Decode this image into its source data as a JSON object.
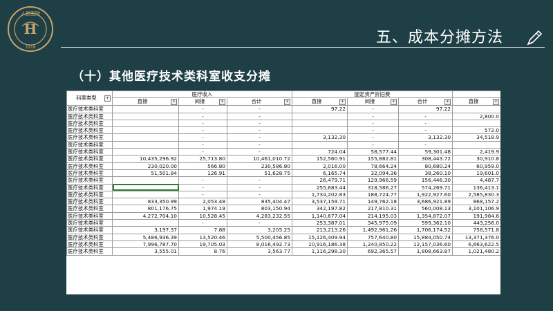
{
  "header": {
    "page_title": "五、成本分摊方法",
    "section_title": "（十）其他医疗技术类科室收支分摊",
    "logo_text": "人民医院 1918"
  },
  "table": {
    "row_header_label": "科室类型",
    "group_medical_income": "医疗收入",
    "group_depreciation": "固定资产折旧费",
    "col_labels": [
      "直接",
      "间接",
      "合计",
      "直接",
      "间接",
      "合计",
      "直接"
    ],
    "rows": [
      {
        "type": "医疗技术类科室",
        "c1": "",
        "c2": "-",
        "c3": "-",
        "c4": "97.22",
        "c5": "-",
        "c6": "97.22",
        "c7": ""
      },
      {
        "type": "医疗技术类科室",
        "c1": "",
        "c2": "-",
        "c3": "-",
        "c4": "",
        "c5": "-",
        "c6": "-",
        "c7": "2,800.0"
      },
      {
        "type": "医疗技术类科室",
        "c1": "",
        "c2": "-",
        "c3": "-",
        "c4": "",
        "c5": "-",
        "c6": "-",
        "c7": ""
      },
      {
        "type": "医疗技术类科室",
        "c1": "",
        "c2": "-",
        "c3": "-",
        "c4": "",
        "c5": "-",
        "c6": "-",
        "c7": "572.0"
      },
      {
        "type": "医疗技术类科室",
        "c1": "",
        "c2": "-",
        "c3": "-",
        "c4": "3,132.30",
        "c5": "-",
        "c6": "3,132.30",
        "c7": "34,518.9"
      },
      {
        "type": "医疗技术类科室",
        "c1": "",
        "c2": "-",
        "c3": "-",
        "c4": "",
        "c5": "-",
        "c6": "-",
        "c7": ""
      },
      {
        "type": "医疗技术类科室",
        "c1": "",
        "c2": "-",
        "c3": "-",
        "c4": "724.04",
        "c5": "58,577.44",
        "c6": "59,301.48",
        "c7": "2,419.9"
      },
      {
        "type": "医疗技术类科室",
        "c1": "10,435,296.92",
        "c2": "25,713.80",
        "c3": "10,461,010.72",
        "c4": "152,560.91",
        "c5": "155,882.81",
        "c6": "308,443.72",
        "c7": "30,910.8"
      },
      {
        "type": "医疗技术类科室",
        "c1": "230,020.00",
        "c2": "566.80",
        "c3": "230,586.80",
        "c4": "2,016.00",
        "c5": "78,664.24",
        "c6": "80,680.24",
        "c7": "60,959.0"
      },
      {
        "type": "医疗技术类科室",
        "c1": "51,501.84",
        "c2": "126.91",
        "c3": "51,628.75",
        "c4": "6,165.74",
        "c5": "32,094.36",
        "c6": "38,260.10",
        "c7": "19,601.0"
      },
      {
        "type": "医疗技术类科室",
        "c1": "",
        "c2": "-",
        "c3": "-",
        "c4": "26,479.71",
        "c5": "129,966.59",
        "c6": "156,446.30",
        "c7": "4,487.7"
      },
      {
        "type": "医疗技术类科室",
        "c1": "",
        "c2": "-",
        "c3": "-",
        "c4": "255,683.44",
        "c5": "318,586.27",
        "c6": "574,269.71",
        "c7": "136,413.1"
      },
      {
        "type": "医疗技术类科室",
        "c1": "",
        "c2": "-",
        "c3": "-",
        "c4": "1,734,202.83",
        "c5": "188,724.77",
        "c6": "1,922,927.60",
        "c7": "2,585,830.3"
      },
      {
        "type": "医疗技术类科室",
        "c1": "833,350.99",
        "c2": "2,053.48",
        "c3": "835,404.47",
        "c4": "3,537,159.71",
        "c5": "149,762.18",
        "c6": "3,686,921.89",
        "c7": "868,157.2"
      },
      {
        "type": "医疗技术类科室",
        "c1": "801,176.75",
        "c2": "1,974.19",
        "c3": "803,150.94",
        "c4": "342,197.82",
        "c5": "217,810.31",
        "c6": "560,008.13",
        "c7": "3,101,106.9"
      },
      {
        "type": "医疗技术类科室",
        "c1": "4,272,704.10",
        "c2": "10,528.45",
        "c3": "4,283,232.55",
        "c4": "1,140,677.04",
        "c5": "214,195.03",
        "c6": "1,354,872.07",
        "c7": "191,984.6"
      },
      {
        "type": "医疗技术类科室",
        "c1": "",
        "c2": "-",
        "c3": "-",
        "c4": "253,387.01",
        "c5": "345,975.09",
        "c6": "599,362.10",
        "c7": "443,256.0"
      },
      {
        "type": "医疗技术类科室",
        "c1": "3,197.37",
        "c2": "7.88",
        "c3": "3,205.25",
        "c4": "213,213.26",
        "c5": "1,492,961.26",
        "c6": "1,706,174.52",
        "c7": "758,571.8"
      },
      {
        "type": "医疗技术类科室",
        "c1": "5,486,936.39",
        "c2": "13,520.46",
        "c3": "5,500,456.85",
        "c4": "15,126,409.94",
        "c5": "757,640.80",
        "c6": "15,884,050.74",
        "c7": "13,371,376.0"
      },
      {
        "type": "医疗技术类科室",
        "c1": "7,996,787.70",
        "c2": "19,705.03",
        "c3": "8,016,492.73",
        "c4": "10,916,186.38",
        "c5": "1,240,850.22",
        "c6": "12,157,036.60",
        "c7": "6,663,622.5"
      },
      {
        "type": "医疗技术类科室",
        "c1": "3,555.01",
        "c2": "8.76",
        "c3": "3,563.77",
        "c4": "1,116,298.30",
        "c5": "692,365.57",
        "c6": "1,808,663.87",
        "c7": "1,021,480.2"
      }
    ]
  }
}
